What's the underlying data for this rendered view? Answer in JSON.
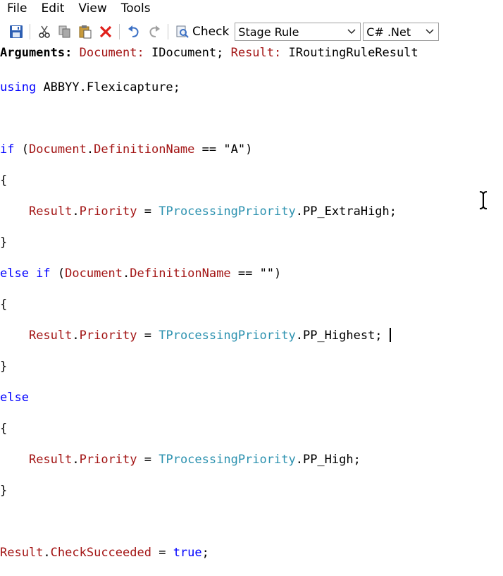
{
  "menu": [
    "File",
    "Edit",
    "View",
    "Tools"
  ],
  "toolbar": {
    "check_label": "Check",
    "stage_select": "Stage Rule",
    "language_select": "C# .Net",
    "icons": [
      "save-icon",
      "cut-icon",
      "copy-icon",
      "paste-icon",
      "delete-icon",
      "undo-icon",
      "redo-icon",
      "check-icon"
    ]
  },
  "arguments": {
    "label": "Arguments:",
    "p1_name": "Document:",
    "p1_type": "IDocument;",
    "p2_name": "Result:",
    "p2_type": "IRoutingRuleResult"
  },
  "code": {
    "using_kw": "using",
    "using_ns": "ABBYY.Flexicapture;",
    "if_kw": "if",
    "else_if_kw": "else if",
    "else_kw": "else",
    "document": "Document",
    "definition_name": "DefinitionName",
    "op_eq": "==",
    "str_a": "\"A\"",
    "str_empty": "\"\"",
    "result": "Result",
    "priority": "Priority",
    "priority_enum": "TProcessingPriority",
    "pp_extrahigh": "PP_ExtraHigh;",
    "pp_highest": "PP_Highest;",
    "pp_high": "PP_High;",
    "check_succeeded": "CheckSucceeded",
    "true_kw": "true"
  }
}
